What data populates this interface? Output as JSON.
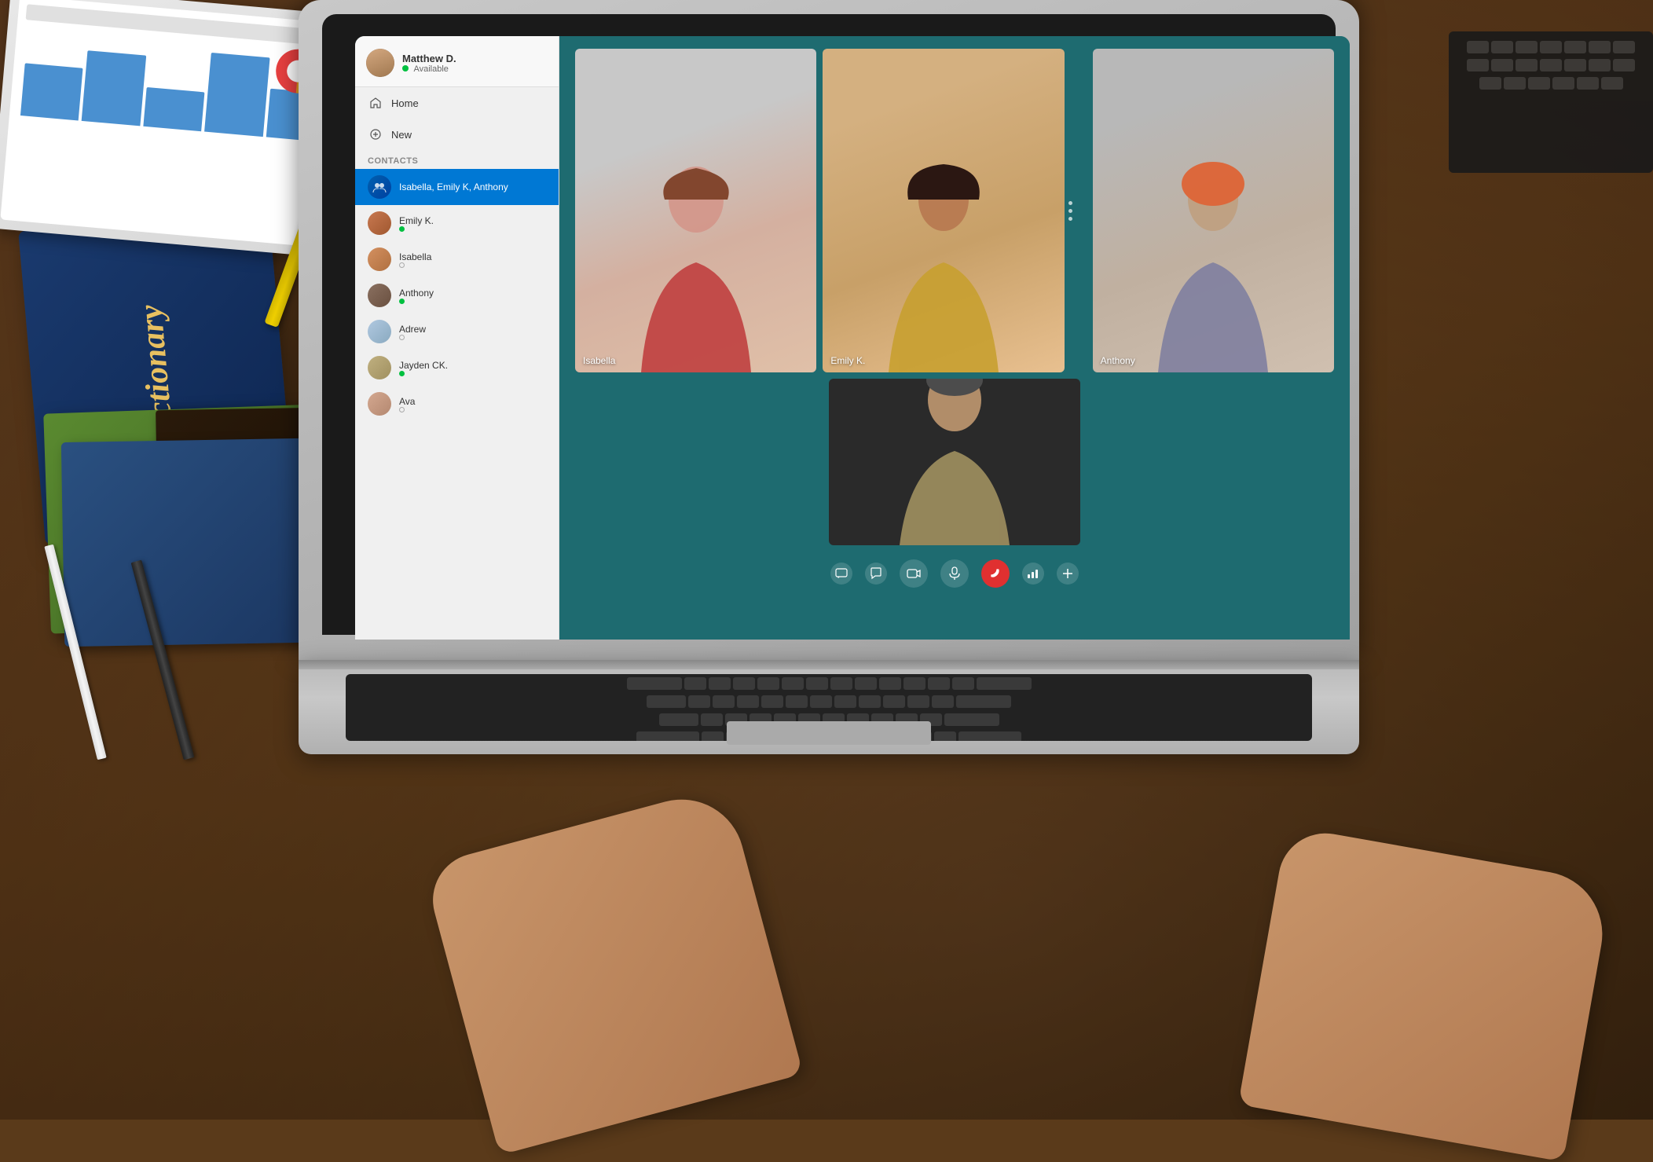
{
  "scene": {
    "title": "Video Call Application on Laptop"
  },
  "app": {
    "profile": {
      "name": "Matthew D.",
      "status": "Available"
    },
    "nav": {
      "home_label": "Home",
      "new_label": "New"
    },
    "contacts": {
      "section_label": "Contacts",
      "active_group": "Isabella, Emily K, Anthony",
      "items": [
        {
          "name": "Emily K.",
          "status": "online",
          "status_color": "green"
        },
        {
          "name": "Isabella",
          "status": "offline",
          "status_color": "empty"
        },
        {
          "name": "Anthony",
          "status": "online",
          "status_color": "green"
        },
        {
          "name": "Adrew",
          "status": "offline",
          "status_color": "empty"
        },
        {
          "name": "Jayden CK.",
          "status": "online",
          "status_color": "green"
        },
        {
          "name": "Ava",
          "status": "offline",
          "status_color": "empty"
        }
      ]
    }
  },
  "video_call": {
    "participants": [
      {
        "id": "isabella",
        "name": "Isabella"
      },
      {
        "id": "emily",
        "name": "Emily K."
      },
      {
        "id": "anthony",
        "name": "Anthony"
      },
      {
        "id": "bottom",
        "name": ""
      }
    ],
    "controls": {
      "chat_icon": "💬",
      "message_icon": "🗨",
      "camera_icon": "📷",
      "mic_icon": "🎤",
      "end_call_icon": "📞",
      "signal_icon": "📶",
      "add_icon": "+"
    }
  },
  "desk_items": {
    "dictionary_text": "Dictionary"
  }
}
